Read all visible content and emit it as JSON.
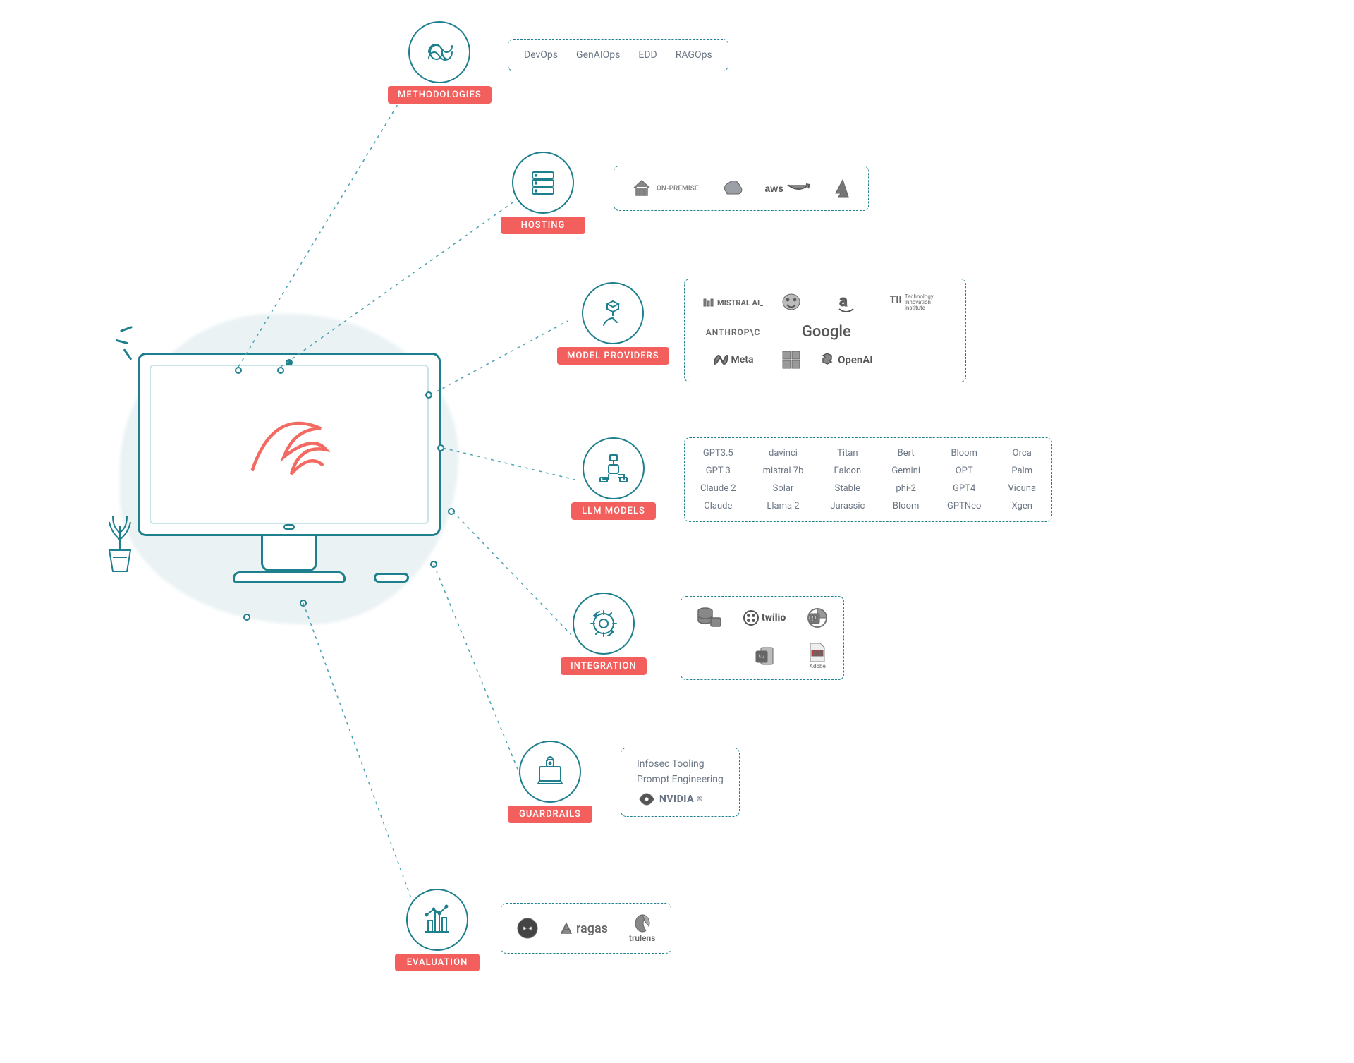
{
  "nodes": {
    "methodologies": {
      "label": "METHODOLOGIES"
    },
    "hosting": {
      "label": "HOSTING"
    },
    "providers": {
      "label": "MODEL PROVIDERS"
    },
    "llm": {
      "label": "LLM MODELS"
    },
    "integration": {
      "label": "INTEGRATION"
    },
    "guardrails": {
      "label": "GUARDRAILS"
    },
    "evaluation": {
      "label": "EVALUATION"
    }
  },
  "methodologies": {
    "items": [
      "DevOps",
      "GenAIOps",
      "EDD",
      "RAGOps"
    ]
  },
  "hosting": {
    "items": [
      {
        "name": "ON-PREMISE"
      },
      {
        "name": "Google Cloud"
      },
      {
        "name": "aws"
      },
      {
        "name": "Azure"
      }
    ]
  },
  "providers": {
    "items": [
      "MISTRAL AI_",
      "Hugging Face",
      "Amazon",
      "TII Technology Innovation Institute",
      "ANTHROP\\C",
      "Google",
      "",
      "",
      "Meta",
      "Microsoft",
      "OpenAI",
      ""
    ],
    "display": {
      "mistral": "MISTRAL AI_",
      "anthropic": "ANTHROP\\C",
      "google": "Google",
      "meta": "Meta",
      "openai": "OpenAI",
      "tii": "TII",
      "tii_sub": "Technology Innovation Institute"
    }
  },
  "llm": {
    "rows": [
      [
        "GPT3.5",
        "davinci",
        "Titan",
        "Bert",
        "Bloom",
        "Orca"
      ],
      [
        "GPT 3",
        "mistral 7b",
        "Falcon",
        "Gemini",
        "OPT",
        "Palm"
      ],
      [
        "Claude 2",
        "Solar",
        "Stable",
        "phi-2",
        "GPT4",
        "Vicuna"
      ],
      [
        "Claude",
        "Llama 2",
        "Jurassic",
        "Bloom",
        "GPTNeo",
        "Xgen"
      ]
    ]
  },
  "integration": {
    "items": [
      "Database",
      "twilio",
      "PowerPoint",
      "Word",
      "PDF Adobe"
    ]
  },
  "guardrails": {
    "lines": [
      "Infosec Tooling",
      "Prompt Engineering"
    ],
    "vendor": "NVIDIA"
  },
  "evaluation": {
    "items": [
      "DeepEval",
      "ragas",
      "trulens"
    ]
  }
}
